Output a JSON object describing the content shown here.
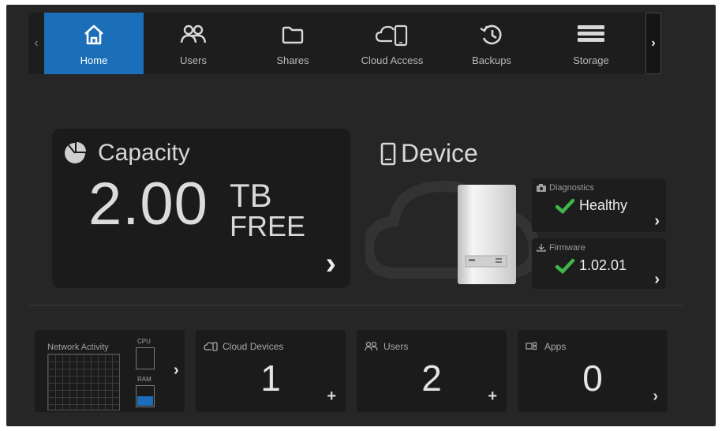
{
  "nav": {
    "items": [
      {
        "label": "Home",
        "icon": "home-icon",
        "active": true
      },
      {
        "label": "Users",
        "icon": "users-icon",
        "active": false
      },
      {
        "label": "Shares",
        "icon": "folder-icon",
        "active": false
      },
      {
        "label": "Cloud Access",
        "icon": "cloud-phone-icon",
        "active": false
      },
      {
        "label": "Backups",
        "icon": "history-icon",
        "active": false
      },
      {
        "label": "Storage",
        "icon": "storage-icon",
        "active": false
      }
    ],
    "prev_arrow": "‹",
    "next_arrow": "›"
  },
  "capacity": {
    "title": "Capacity",
    "value": "2.00",
    "unit": "TB",
    "suffix": "FREE",
    "chevron": "›"
  },
  "device": {
    "title": "Device",
    "diagnostics": {
      "label": "Diagnostics",
      "value": "Healthy"
    },
    "firmware": {
      "label": "Firmware",
      "value": "1.02.01"
    },
    "chevron": "›"
  },
  "network": {
    "title": "Network Activity",
    "cpu_label": "CPU",
    "ram_label": "RAM",
    "ram_level": 0.45,
    "chevron": "›"
  },
  "cards": {
    "cloud_devices": {
      "label": "Cloud Devices",
      "count": "1",
      "action": "+"
    },
    "users": {
      "label": "Users",
      "count": "2",
      "action": "+"
    },
    "apps": {
      "label": "Apps",
      "count": "0",
      "action": "›"
    }
  },
  "colors": {
    "accent": "#1a6fb8",
    "check": "#3fb54a",
    "background": "#262626",
    "card": "#1b1b1b"
  }
}
